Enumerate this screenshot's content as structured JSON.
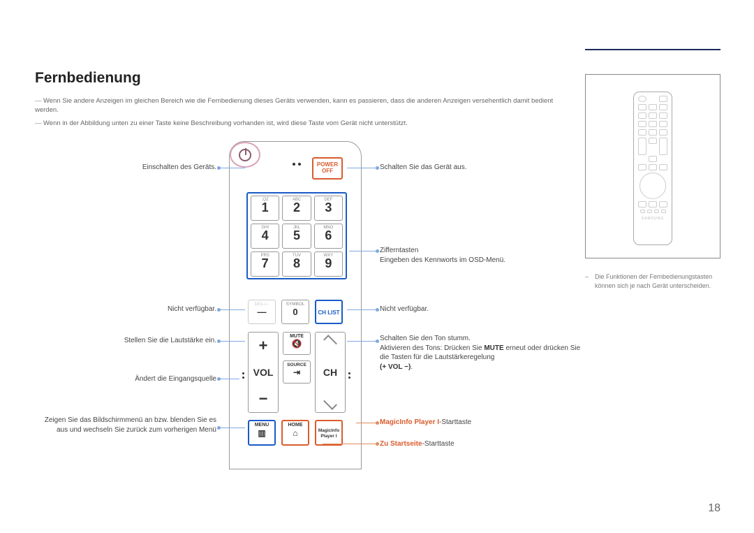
{
  "page": {
    "title": "Fernbedienung",
    "number": "18"
  },
  "intro": {
    "line1": "Wenn Sie andere Anzeigen im gleichen Bereich wie die Fernbedienung dieses Geräts verwenden, kann es passieren, dass die anderen Anzeigen versehentlich damit bedient werden.",
    "line2": "Wenn in der Abbildung unten zu einer Taste keine Beschreibung vorhanden ist, wird diese Taste vom Gerät nicht unterstützt."
  },
  "remote": {
    "power_off": {
      "line1": "POWER",
      "line2": "OFF"
    },
    "numpad": [
      {
        "sub": ".QZ",
        "digit": "1"
      },
      {
        "sub": "ABC",
        "digit": "2"
      },
      {
        "sub": "DEF",
        "digit": "3"
      },
      {
        "sub": "GHI",
        "digit": "4"
      },
      {
        "sub": "JKL",
        "digit": "5"
      },
      {
        "sub": "MNO",
        "digit": "6"
      },
      {
        "sub": "PRS",
        "digit": "7"
      },
      {
        "sub": "TUV",
        "digit": "8"
      },
      {
        "sub": "WXY",
        "digit": "9"
      }
    ],
    "del_label": "DEL-/--",
    "symbol_label": "SYMBOL",
    "symbol_digit": "0",
    "chlist_label": "CH LIST",
    "vol_label": "VOL",
    "ch_label": "CH",
    "mute_label": "MUTE",
    "source_label": "SOURCE",
    "menu_label": "MENU",
    "home_label": "HOME",
    "magic_label1": "MagicInfo",
    "magic_label2": "Player I",
    "plus": "+",
    "minus": "−",
    "del_icon": "—"
  },
  "left_callouts": {
    "power": "Einschalten des Geräts.",
    "na1": "Nicht verfügbar.",
    "vol": "Stellen Sie die Lautstärke ein.",
    "source": "Ändert die Eingangsquelle",
    "menu": "Zeigen Sie das Bildschirmmenü an bzw. blenden Sie es aus und wechseln Sie zurück zum vorherigen Menü"
  },
  "right_callouts": {
    "power_off": "Schalten Sie das Gerät aus.",
    "numpad_l1": "Zifferntasten",
    "numpad_l2": "Eingeben des Kennworts im OSD-Menü.",
    "chlist": "Nicht verfügbar.",
    "mute_l1": "Schalten Sie den Ton stumm.",
    "mute_l2a": "Aktivieren des Tons: Drücken Sie ",
    "mute_bold": "MUTE",
    "mute_l2b": " erneut oder drücken Sie die Tasten für die Lautstärkeregelung ",
    "mute_l3": "(+ VOL -)",
    "mute_l3_suffix": ".",
    "magic_prefix": "MagicInfo Player I",
    "magic_suffix": "-Starttaste",
    "home_prefix": "Zu Startseite",
    "home_suffix": "-Starttaste"
  },
  "sidebar": {
    "brand": "SAMSUNG",
    "note": "Die Funktionen der Fernbedienungstasten können sich je nach Gerät unterscheiden."
  }
}
